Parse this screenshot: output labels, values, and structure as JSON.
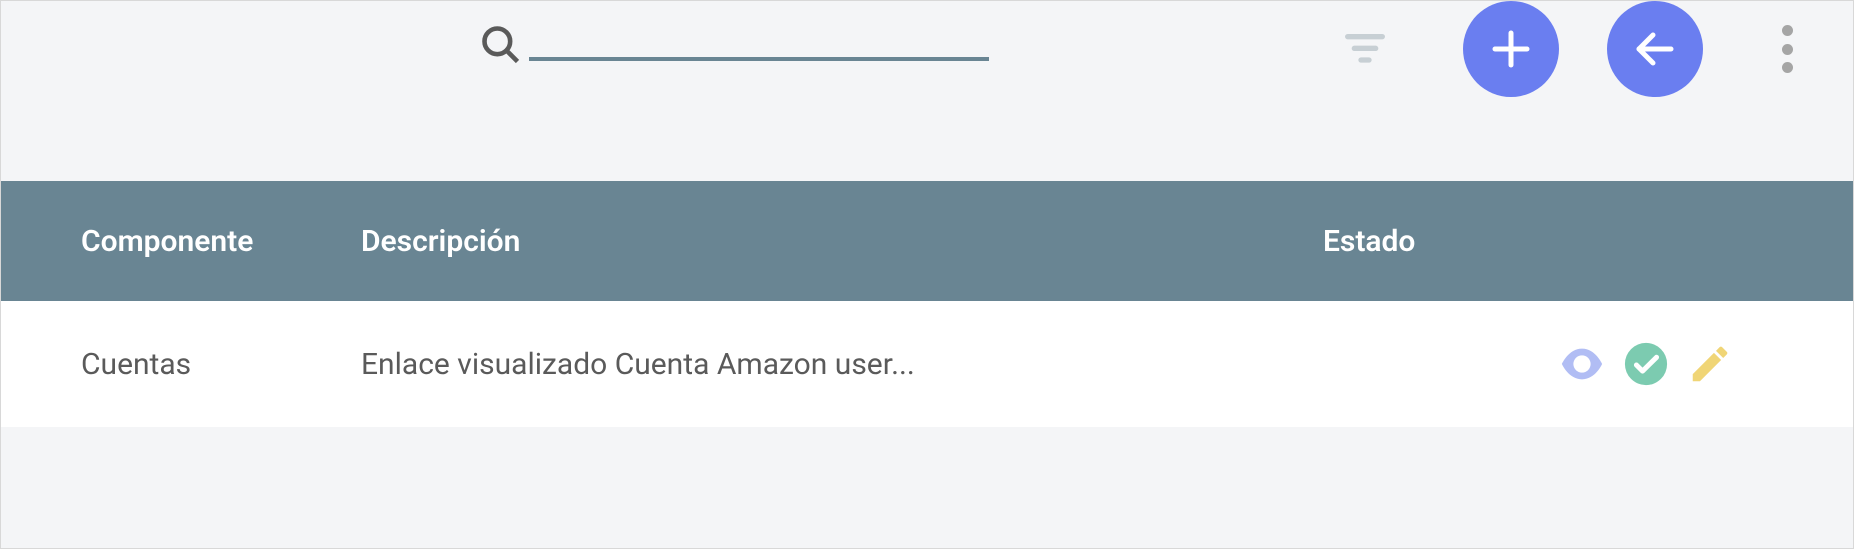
{
  "search": {
    "value": "",
    "placeholder": ""
  },
  "table": {
    "headers": {
      "componente": "Componente",
      "descripcion": "Descripción",
      "estado": "Estado"
    },
    "rows": [
      {
        "componente": "Cuentas",
        "descripcion": "Enlace visualizado Cuenta Amazon user..."
      }
    ]
  },
  "icons": {
    "search": "search-icon",
    "filter": "filter-icon",
    "add": "plus-icon",
    "back": "back-arrow-icon",
    "more": "more-vertical-icon",
    "view": "eye-icon",
    "ok": "check-circle-icon",
    "edit": "pencil-icon"
  },
  "colors": {
    "accent": "#6a7ef0",
    "headerBg": "#698593",
    "eye": "#b1bdf4",
    "check": "#7ccbb0",
    "pencil": "#f0d576"
  }
}
